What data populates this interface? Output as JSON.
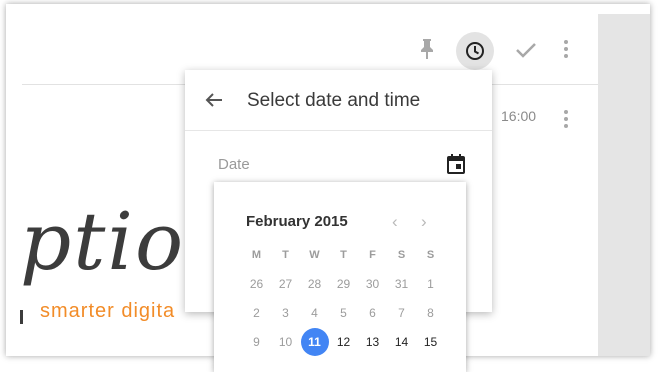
{
  "toolbar": {
    "pin_icon": "pin-icon",
    "clock_icon": "clock-icon",
    "check_icon": "check-icon",
    "more_icon": "more-vert-icon"
  },
  "row": {
    "time": "16:00"
  },
  "logo": {
    "word": "ption",
    "tagline": "smarter digita"
  },
  "dialog": {
    "title": "Select date and time",
    "date_label": "Date"
  },
  "calendar": {
    "month": "February 2015",
    "weekdays": [
      "M",
      "T",
      "W",
      "T",
      "F",
      "S",
      "S"
    ],
    "weeks": [
      [
        "26",
        "27",
        "28",
        "29",
        "30",
        "31",
        "1"
      ],
      [
        "2",
        "3",
        "4",
        "5",
        "6",
        "7",
        "8"
      ],
      [
        "9",
        "10",
        "11",
        "12",
        "13",
        "14",
        "15"
      ]
    ],
    "selected": "11",
    "colors": {
      "selected": "#4285f4",
      "accent_logo": "#f28c28"
    }
  }
}
